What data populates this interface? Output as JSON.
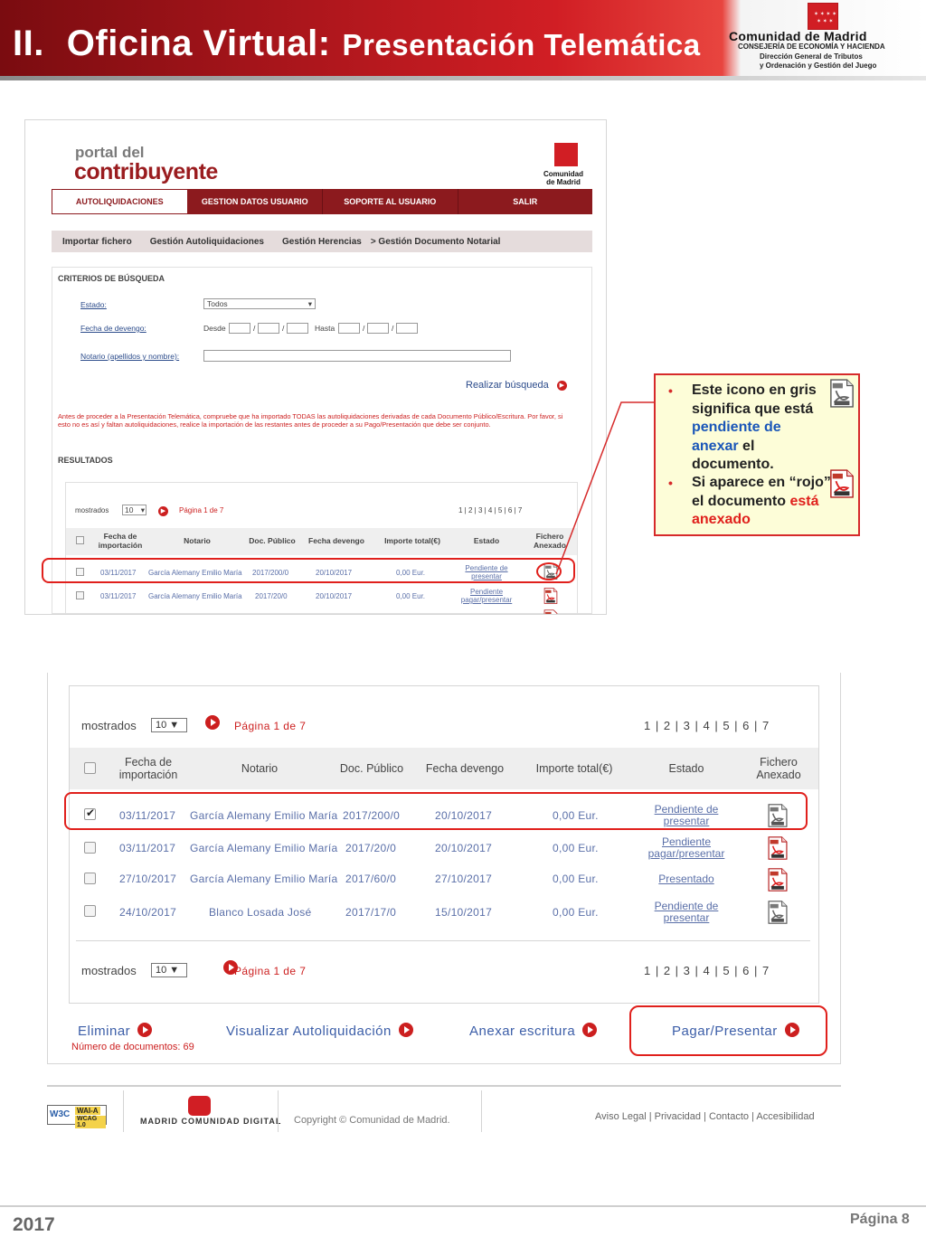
{
  "slide": {
    "title_prefix": "II.",
    "title_main": "Oficina Virtual:",
    "title_sub": "Presentación Telemática",
    "org_name": "Comunidad de Madrid",
    "org_dept": "CONSEJERÍA DE ECONOMÍA Y HACIENDA",
    "org_sub1": "Dirección General de Tributos",
    "org_sub2": "y Ordenación y Gestión del Juego",
    "year": "2017",
    "page": "Página 8",
    "colors": {
      "brand_red": "#d11e24",
      "dark_red": "#8c1a1e",
      "link_blue": "#2a4a8a"
    }
  },
  "portal": {
    "title_line1": "portal del",
    "title_line2": "contribuyente",
    "logo_line1": "Comunidad",
    "logo_line2": "de Madrid",
    "nav": [
      "AUTOLIQUIDACIONES",
      "GESTION DATOS USUARIO",
      "SOPORTE AL USUARIO",
      "SALIR"
    ],
    "subnav": [
      "Importar fichero",
      "Gestión Autoliquidaciones",
      "Gestión Herencias",
      "> Gestión Documento Notarial"
    ],
    "criteria_title": "CRITERIOS DE BÚSQUEDA",
    "estado_label": "Estado:",
    "estado_value": "Todos",
    "fecha_label": "Fecha de devengo:",
    "desde": "Desde",
    "hasta": "Hasta",
    "notario_label": "Notario (apellidos y nombre):",
    "search_link": "Realizar búsqueda",
    "warning": "Antes de proceder a la Presentación Telemática, compruebe que ha importado TODAS las autoliquidaciones derivadas de cada Documento Público/Escritura. Por favor, si esto no es así y faltan autoliquidaciones, realice la importación de las restantes antes de proceder a su Pago/Presentación que debe ser conjunto.",
    "results_title": "RESULTADOS",
    "mostrados": "mostrados",
    "page_size": "10",
    "pagina": "Página 1 de 7",
    "pages": "1 | 2 | 3 | 4 | 5 | 6 | 7",
    "headers": [
      "Fecha de importación",
      "Notario",
      "Doc. Público",
      "Fecha devengo",
      "Importe total(€)",
      "Estado",
      "Fichero Anexado"
    ],
    "rows": [
      {
        "fecha": "03/11/2017",
        "notario": "García Alemany Emilio María",
        "doc": "2017/200/0",
        "devengo": "20/10/2017",
        "importe": "0,00 Eur.",
        "estado1": "Pendiente de",
        "estado2": "presentar"
      },
      {
        "fecha": "03/11/2017",
        "notario": "García Alemany Emilio María",
        "doc": "2017/20/0",
        "devengo": "20/10/2017",
        "importe": "0,00 Eur.",
        "estado1": "Pendiente",
        "estado2": "pagar/presentar"
      }
    ]
  },
  "callout": {
    "item1_a": "Este icono en gris significa que está ",
    "item1_b": "pendiente de anexar",
    "item1_c": " el documento.",
    "item2_a": "Si aparece en “rojo” el documento ",
    "item2_b": "está anexado"
  },
  "detail": {
    "mostrados": "mostrados",
    "page_size": "10 ▼",
    "pagina": "Página 1 de 7",
    "pages": "1 | 2 | 3 | 4 | 5 | 6 | 7",
    "headers": [
      "Fecha de importación",
      "Notario",
      "Doc. Público",
      "Fecha devengo",
      "Importe total(€)",
      "Estado",
      "Fichero Anexado"
    ],
    "rows": [
      {
        "checked": true,
        "fecha": "03/11/2017",
        "notario": "García Alemany Emilio María",
        "doc": "2017/200/0",
        "devengo": "20/10/2017",
        "importe": "0,00 Eur.",
        "estado1": "Pendiente de",
        "estado2": "presentar",
        "icon": "pdf-gray-icon"
      },
      {
        "checked": false,
        "fecha": "03/11/2017",
        "notario": "García Alemany Emilio María",
        "doc": "2017/20/0",
        "devengo": "20/10/2017",
        "importe": "0,00 Eur.",
        "estado1": "Pendiente",
        "estado2": "pagar/presentar",
        "icon": "pdf-red-icon"
      },
      {
        "checked": false,
        "fecha": "27/10/2017",
        "notario": "García Alemany Emilio María",
        "doc": "2017/60/0",
        "devengo": "27/10/2017",
        "importe": "0,00 Eur.",
        "estado1": "Presentado",
        "estado2": "",
        "icon": "pdf-red-icon"
      },
      {
        "checked": false,
        "fecha": "24/10/2017",
        "notario": "Blanco Losada José",
        "doc": "2017/17/0",
        "devengo": "15/10/2017",
        "importe": "0,00 Eur.",
        "estado1": "Pendiente de",
        "estado2": "presentar",
        "icon": "pdf-gray-icon"
      }
    ],
    "actions": [
      "Eliminar",
      "Visualizar Autoliquidación",
      "Anexar escritura",
      "Pagar/Presentar"
    ],
    "doc_count": "Número de documentos: 69"
  },
  "site_footer": {
    "wai": "WAI-A",
    "wcag": "WCAG 1.0",
    "madrid_digital": "MADRID COMUNIDAD DIGITAL",
    "copyright": "Copyright © Comunidad de Madrid.",
    "links": "Aviso Legal | Privacidad | Contacto | Accesibilidad"
  }
}
